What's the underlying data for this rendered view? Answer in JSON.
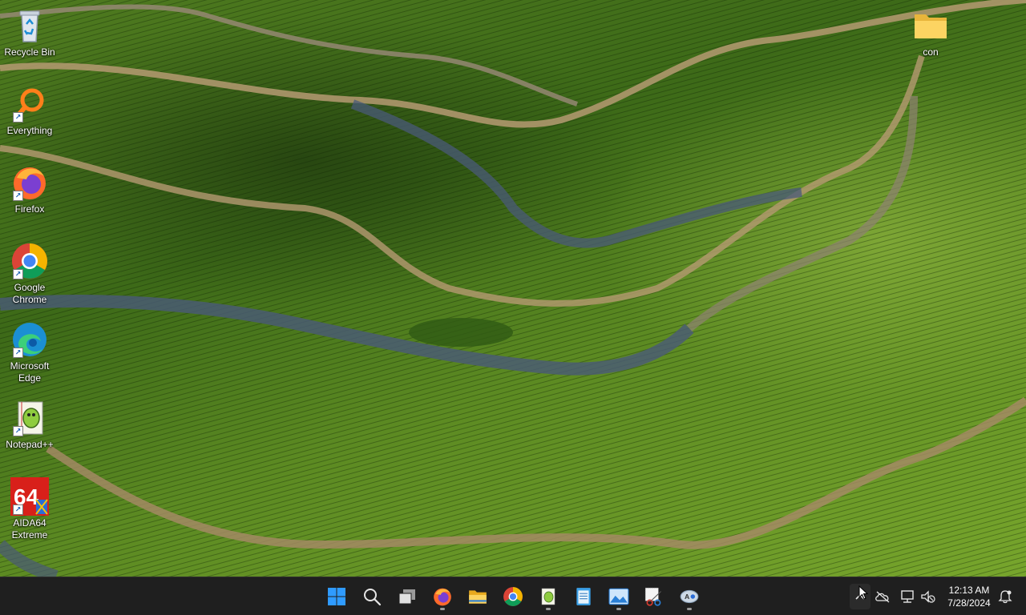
{
  "desktop": {
    "icons": [
      {
        "label": "Recycle Bin"
      },
      {
        "label": "Everything"
      },
      {
        "label": "Firefox"
      },
      {
        "label": "Google Chrome"
      },
      {
        "label": "Microsoft Edge"
      },
      {
        "label": "Notepad++"
      },
      {
        "label": "AIDA64 Extreme"
      },
      {
        "label": "con"
      }
    ],
    "aida_badge": "64"
  },
  "taskbar": {
    "apps": [
      "start-icon",
      "search-icon",
      "task-view-icon",
      "firefox-icon",
      "file-explorer-icon",
      "chrome-icon",
      "notepadpp-icon",
      "notepad-icon",
      "photos-icon",
      "snipping-tool-icon",
      "aida64-icon"
    ]
  },
  "tray": {
    "time": "12:13 AM",
    "date": "7/28/2024"
  },
  "colors": {
    "taskbar_bg": "#1f1f1f",
    "accent": "#0a84ff"
  }
}
